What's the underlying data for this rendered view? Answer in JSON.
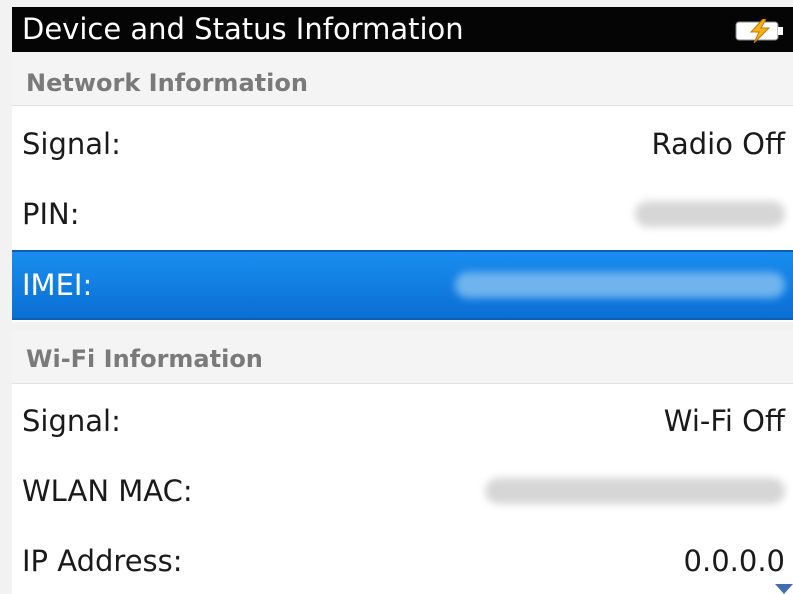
{
  "title": "Device and Status Information",
  "icons": {
    "battery": "battery-charging-icon",
    "scroll": "scroll-down-arrow-icon"
  },
  "colors": {
    "titlebar_bg": "#050505",
    "selection": "#1a7fe6",
    "section_header_text": "#7a7a7a"
  },
  "network": {
    "header": "Network Information",
    "signal_label": "Signal:",
    "signal_value": "Radio Off",
    "pin_label": "PIN:",
    "imei_label": "IMEI:"
  },
  "wifi": {
    "header": "Wi-Fi Information",
    "signal_label": "Signal:",
    "signal_value": "Wi-Fi Off",
    "mac_label": "WLAN MAC:",
    "ip_label": "IP Address:",
    "ip_value": "0.0.0.0"
  }
}
